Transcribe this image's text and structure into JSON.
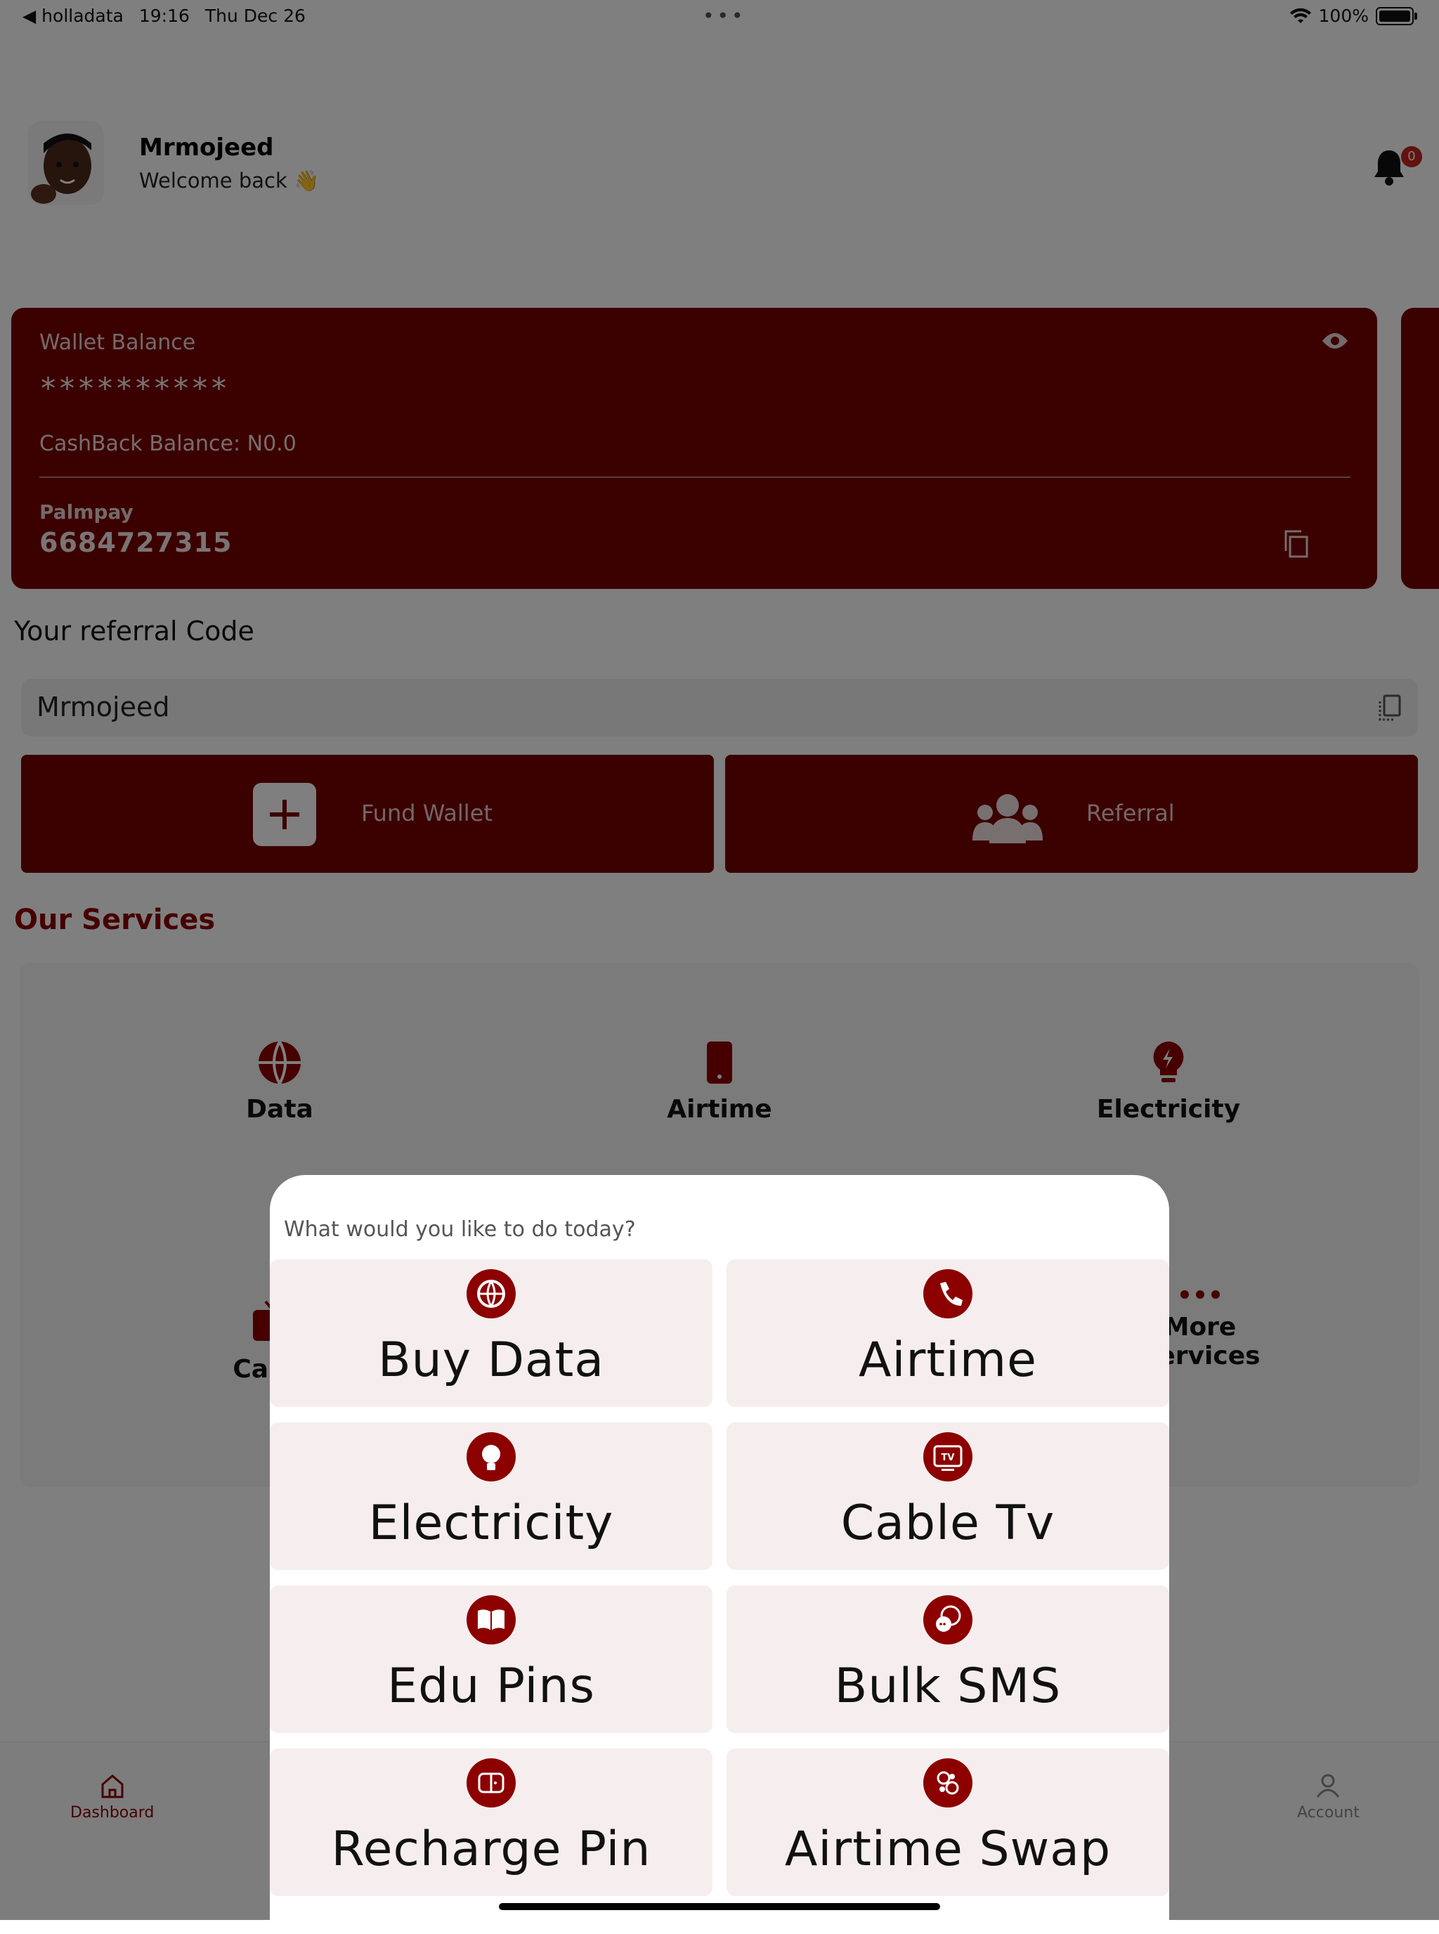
{
  "status_bar": {
    "back_app": "◀ holladata",
    "time": "19:16",
    "date": "Thu Dec 26",
    "battery": "100%"
  },
  "header": {
    "username": "Mrmojeed",
    "welcome": "Welcome back 👋",
    "notification_count": "0"
  },
  "wallet": {
    "label": "Wallet Balance",
    "masked_balance": "**********",
    "cashback": "CashBack Balance: N0.0",
    "bank_name": "Palmpay",
    "account_number": "6684727315"
  },
  "referral": {
    "title": "Your referral Code",
    "code": "Mrmojeed"
  },
  "actions": {
    "fund_wallet": "Fund Wallet",
    "referral": "Referral"
  },
  "services": {
    "title": "Our Services",
    "items": [
      {
        "label": "Data",
        "icon": "globe-icon"
      },
      {
        "label": "Airtime",
        "icon": "phone-icon"
      },
      {
        "label": "Electricity",
        "icon": "bulb-icon"
      },
      {
        "label": "Cable",
        "icon": "tv-icon"
      },
      {
        "label": "More Services",
        "icon": "more-icon"
      }
    ]
  },
  "bottom_nav": {
    "dashboard": "Dashboard",
    "account": "Account"
  },
  "modal": {
    "prompt": "What would you like to do today?",
    "tiles": [
      {
        "label": "Buy Data",
        "icon": "globe-icon"
      },
      {
        "label": "Airtime",
        "icon": "phone-icon"
      },
      {
        "label": "Electricity",
        "icon": "bulb-icon"
      },
      {
        "label": "Cable Tv",
        "icon": "tv-icon"
      },
      {
        "label": "Edu Pins",
        "icon": "book-icon"
      },
      {
        "label": "Bulk SMS",
        "icon": "chat-icon"
      },
      {
        "label": "Recharge Pin",
        "icon": "recharge-icon"
      },
      {
        "label": "Airtime Swap",
        "icon": "swap-icon"
      }
    ]
  },
  "colors": {
    "brand": "#760000",
    "accent": "#8c0000"
  }
}
